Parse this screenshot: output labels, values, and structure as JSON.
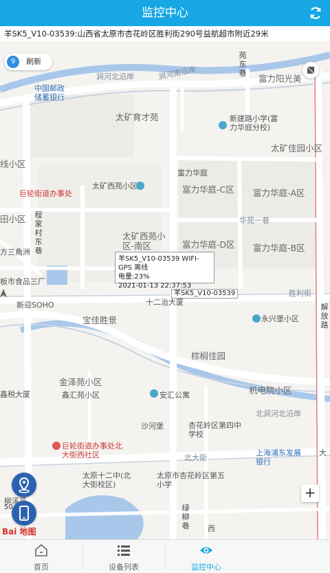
{
  "header": {
    "title": "监控中心"
  },
  "address": {
    "text": "羊SK5_V10-03539:山西省太原市杏花岭区胜利街290号益航超市附近29米"
  },
  "map": {
    "refresh": {
      "count": "9",
      "label": "刷新"
    },
    "labels": {
      "l1": "富力阳光美",
      "l2": "中国邮政储蓄银行",
      "l3": "太矿育才苑",
      "l4": "新建路小学(富力华庭分校)",
      "l5": "太矿佳园小区",
      "l6": "线小区",
      "l7": "富力华庭",
      "l8": "巨轮街道办事处",
      "l9": "太矿西苑小区",
      "l10": "富力华庭-C区",
      "l11": "富力华庭-A区",
      "l12": "田小区",
      "l13": "华苑一巷",
      "l14": "太矿西苑小区-南区",
      "l15": "富力华庭-D区",
      "l16": "富力华庭-B区",
      "l17": "方三角洲",
      "l18": "板市食品三厂",
      "l19": "新迎SOHO",
      "l20": "十二治大厦",
      "l21": "胜利街",
      "l22": "宝佳胜景",
      "l23": "永兴堡小区",
      "l24": "棕榈佳园",
      "l25": "金泽苑小区",
      "l26": "机电院小区",
      "l27": "鑫税大厦",
      "l28": "鑫汇苑小区",
      "l29": "安汇公寓",
      "l30": "北涧河北沿岸",
      "l31": "沙河堡",
      "l32": "杏花岭区第四中学校",
      "l33": "巨轮街道办事处北大街西社区",
      "l34": "北大街",
      "l35": "上海浦东发展银行",
      "l36": "大",
      "l37": "太原十二中(北大街校区)",
      "l38": "太原市杏花岭区第五小学",
      "l39": "柳溪花",
      "l40": "西",
      "road1": "涧河北沿岸",
      "road2": "涧河南沿岸",
      "v1": "苑东巷",
      "v2": "程家村东巷",
      "v3": "绿柳巷",
      "v4": "解放路"
    },
    "popup": {
      "line1": "羊SK5_V10-03539 WIFI-GPS 离线",
      "line2": "电量:23%",
      "line3": "2021-01-13 22:37:53"
    },
    "device_tag": "羊SK5_V10-03539",
    "zoom_in": "+",
    "scale": "50",
    "logo": "Bai 地图"
  },
  "tabs": [
    {
      "label": "首页",
      "icon": "home-icon"
    },
    {
      "label": "设备列表",
      "icon": "list-icon"
    },
    {
      "label": "监控中心",
      "icon": "eye-icon"
    }
  ],
  "colors": {
    "accent": "#17a7e4",
    "fab": "#2b62b0"
  }
}
